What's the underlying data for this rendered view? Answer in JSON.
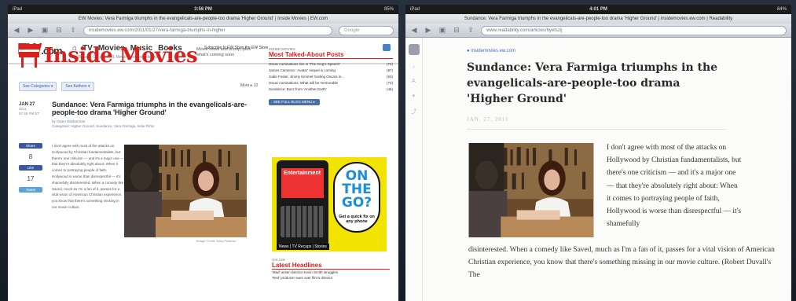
{
  "left": {
    "status": {
      "carrier": "iPad",
      "time": "3:56 PM",
      "battery": "85%"
    },
    "tab_title": "EW Movies: Vera Farmiga triumphs in the evangelicals-are-people-too drama 'Higher Ground' | Inside Movies | EW.com",
    "url": "insidemovies.ew.com/2011/01/27/vera-farmiga-triumphs-in-higher",
    "search_placeholder": "Google",
    "site": {
      "logo": "EW",
      "logo_suffix": ".com",
      "nav": [
        "TV",
        "Movies",
        "Music",
        "Books"
      ],
      "nav_sub": "TV Recaps   Oscars 2011   Movie Reviews   Television",
      "top_links": "Subscribe to EW   Shop the EW Store"
    },
    "blog": {
      "title": "Inside Movies",
      "tagline": "Movie news and scoop, plus what's coming soon",
      "categories_pill": "See Categories ▾",
      "authors_pill": "See Authors ▾",
      "post_info": "More ▸ 10",
      "date": "JAN 27",
      "year": "2011",
      "time": "07:48 PM ET",
      "headline": "Sundance: Vera Farmiga triumphs in the evangelicals-are-people-too drama 'Higher Ground'",
      "byline": "by Owen Gleiberman",
      "tags": "Categories: Higher Ground, Sundance, Vera Farmiga, Indie Films",
      "shares": [
        {
          "label": "Share",
          "count": ""
        },
        {
          "label": "Like",
          "count": "8"
        },
        {
          "label": "Tweet",
          "count": "17"
        }
      ],
      "body": "I don't agree with most of the attacks on Hollywood by Christian fundamentalists, but there's one criticism — and it's a major one — that they're absolutely right about: When it comes to portraying people of faith, Hollywood is worse than disrespectful — it's shamefully disinterested. When a comedy like Saved, much as I'm a fan of it, passes for a vital vision of American Christian experience, you know that there's something missing in our movie culture.",
      "caption": "Image Credit: Sony Pictures"
    },
    "sidebar": {
      "label": "INSIDE MOVIES",
      "heading": "Most Talked-About Posts",
      "items": [
        {
          "t": "Oscar nominations live in 'The King's Speech'",
          "c": "(74)"
        },
        {
          "t": "James Cameron: 'Avatar' sequel is coming",
          "c": "(87)"
        },
        {
          "t": "Jodie Foster, Jimmy Kimmel hosting Oscars in...",
          "c": "(53)"
        },
        {
          "t": "Oscar nominations: What will be memorable",
          "c": "(72)"
        },
        {
          "t": "Sundance: Buzz from 'Another Earth'",
          "c": "(46)"
        }
      ],
      "more": "SEE FULL BLOG MENU ▸",
      "ad": {
        "brand": "Entertainment",
        "headline": "ON THE GO?",
        "sub": "Get a quick fix on any phone",
        "nav": "News | TV Recaps | Stories"
      },
      "latest_label": "Get Link",
      "latest_heading": "Latest Headlines",
      "latest": [
        "'Mad' writer-director Kevin Smith struggles",
        "'Red' producer sues over film's director"
      ]
    }
  },
  "right": {
    "status": {
      "carrier": "iPad",
      "time": "4:01 PM",
      "battery": "84%"
    },
    "tab_title": "Sundance: Vera Farmiga triumphs in the evangelicals-are-people-too drama 'Higher Ground' | insidemovies.ew.com | Readability",
    "url": "www.readability.com/articles/hyetszij",
    "source": "insidemovies.ew.com",
    "title": "Sundance: Vera Farmiga triumphs in the evangelicals-are-people-too drama 'Higher Ground'",
    "date": "JAN. 27, 2011",
    "para_wrap": "I don't agree with most of the attacks on Hollywood by Christian fundamentalists, but there's one criticism — and it's a major one — that they're absolutely right about: When it comes to portraying people of faith, Hollywood is worse than disrespectful — it's shamefully",
    "para_full": "disinterested. When a comedy like Saved, much as I'm a fan of it, passes for a vital vision of American Christian experience, you know that there's something missing in our movie culture. (Robert Duvall's The"
  }
}
